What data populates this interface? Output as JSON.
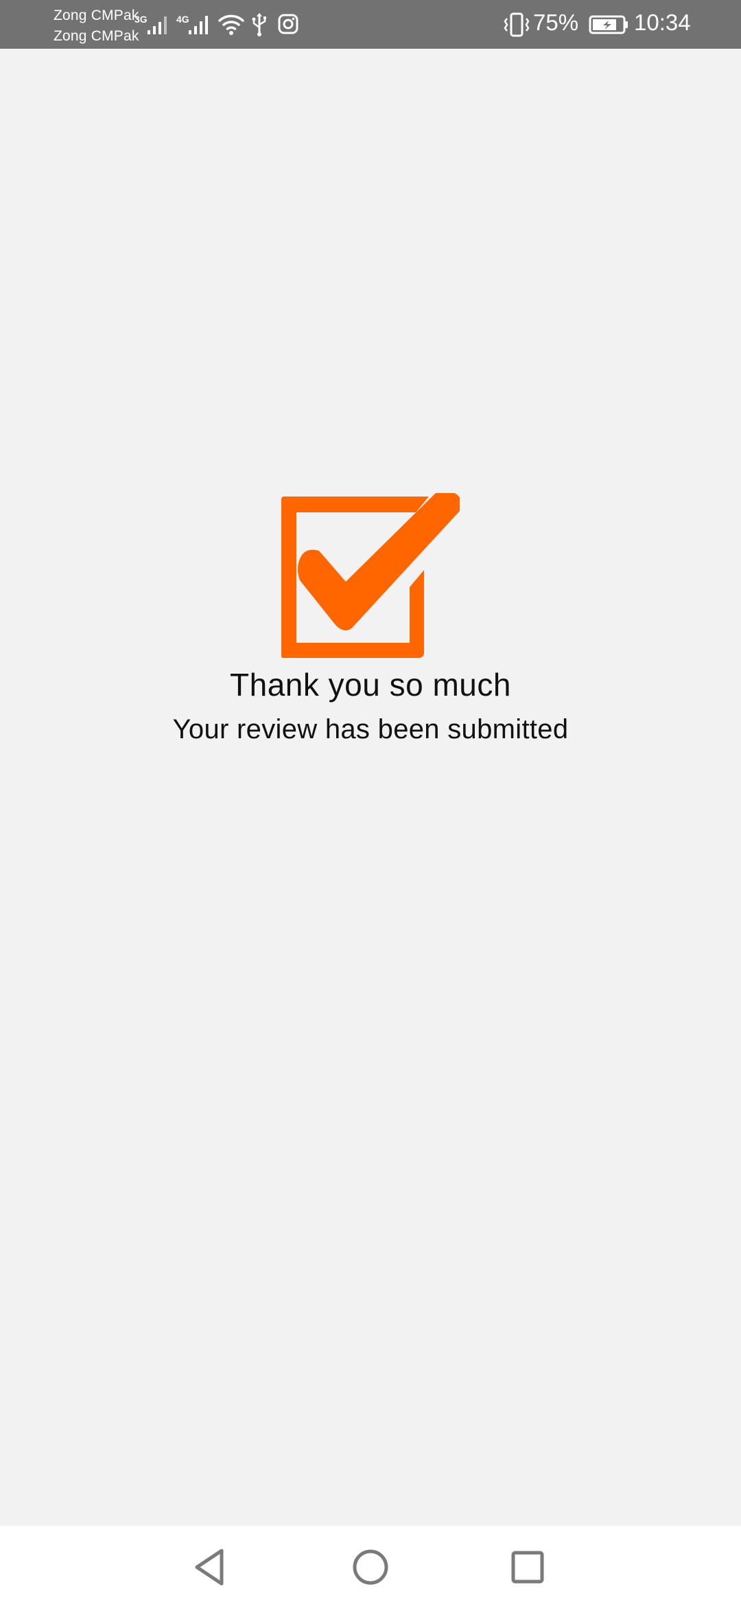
{
  "status_bar": {
    "carrier_1": "Zong CMPak",
    "carrier_2": "Zong CMPak",
    "net_type_1": "3G",
    "net_type_2": "4G",
    "battery_percent": "75%",
    "time": "10:34",
    "icons": [
      "signal-3g-icon",
      "signal-4g-icon",
      "wifi-icon",
      "usb-icon",
      "instagram-icon",
      "vibrate-icon",
      "battery-charging-icon"
    ]
  },
  "content": {
    "icon": "checkbox-checked-icon",
    "title": "Thank you so much",
    "subtitle": "Your review has been submitted"
  },
  "nav_bar": {
    "icons": [
      "back-icon",
      "home-icon",
      "recents-icon"
    ]
  },
  "colors": {
    "accent": "#ff6600",
    "status_bar_bg": "#727272",
    "page_bg": "#f2f2f2",
    "nav_bg": "#ffffff",
    "nav_icon": "#7a7a7a",
    "text": "#111111"
  }
}
